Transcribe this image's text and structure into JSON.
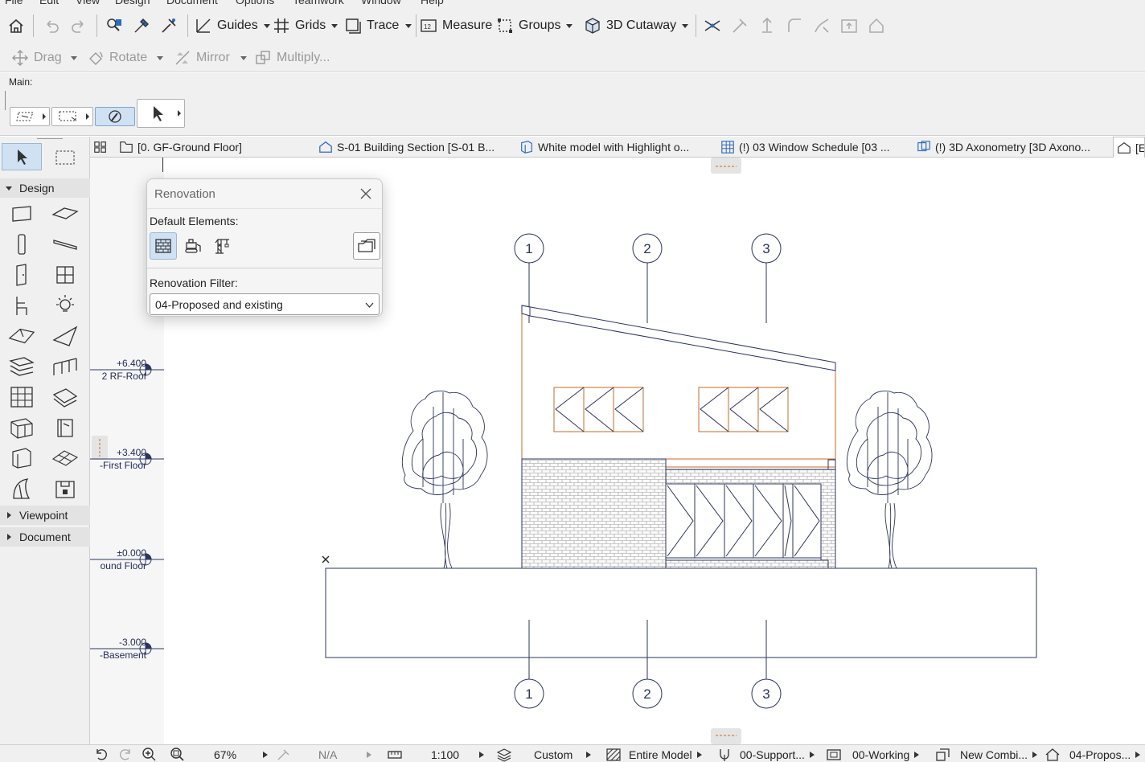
{
  "menubar": {
    "items": [
      "File",
      "Edit",
      "View",
      "Design",
      "Document",
      "Options",
      "Teamwork",
      "Window",
      "Help"
    ]
  },
  "toolbar_main": {
    "guides": "Guides",
    "grids": "Grids",
    "trace": "Trace",
    "measure": "Measure",
    "groups": "Groups",
    "cutaway": "3D Cutaway"
  },
  "toolbar_edit": {
    "drag": "Drag",
    "rotate": "Rotate",
    "mirror": "Mirror",
    "multiply": "Multiply..."
  },
  "info_box": {
    "label": "Main:"
  },
  "tabs": [
    "[0. GF-Ground Floor]",
    "S-01 Building Section [S-01 B...",
    "White model with Highlight o...",
    "(!) 03 Window Schedule [03 ...",
    "(!) 3D Axonometry [3D Axono...",
    "[E"
  ],
  "toolbox": {
    "design": "Design",
    "viewpoint": "Viewpoint",
    "document": "Document"
  },
  "levels": [
    {
      "value": "+6.400",
      "name": "2 RF-Roof"
    },
    {
      "value": "+3.400",
      "name": "-First Floor"
    },
    {
      "value": "±0.000",
      "name": "ound Floor"
    },
    {
      "value": "-3.000",
      "name": "-Basement"
    }
  ],
  "grid_labels": {
    "top": [
      "1",
      "2",
      "3"
    ],
    "bottom": [
      "1",
      "2",
      "3"
    ]
  },
  "renovation_palette": {
    "title": "Renovation",
    "default_elements_label": "Default Elements:",
    "filter_label": "Renovation Filter:",
    "filter_value": "04-Proposed and existing"
  },
  "statusbar": {
    "zoom": "67%",
    "angle": "N/A",
    "scale": "1:100",
    "pen_set": "Custom",
    "model_view": "Entire Model",
    "layer_combo": "00-Support...",
    "dimension": "00-Working",
    "graphic_override": "New Combi...",
    "renovation": "04-Propos..."
  },
  "colors": {
    "drawing_line": "#2a3560",
    "renovation_new": "#cc6a1f",
    "accent": "#cfe1f3"
  }
}
